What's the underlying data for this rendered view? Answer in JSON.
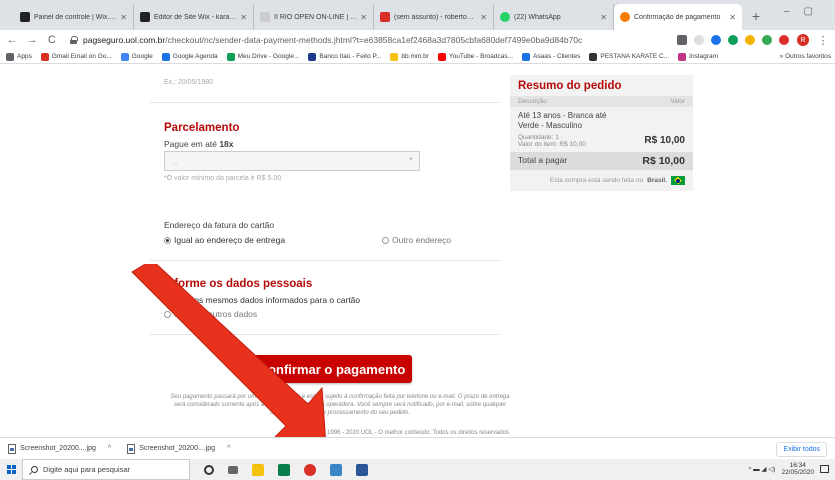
{
  "browser": {
    "tabs": [
      {
        "label": "Painel de controle | Wix.com",
        "color": "#222222"
      },
      {
        "label": "Editor de Site Wix - karateno",
        "color": "#222222"
      },
      {
        "label": "II RIO OPEN ON-LINE | karat",
        "color": "#cccccc"
      },
      {
        "label": "(sem assunto) - robertopesta",
        "color": "#d93025"
      },
      {
        "label": "(22) WhatsApp",
        "color": "#25d366"
      },
      {
        "label": "Confirmação de pagamento",
        "color": "#f57c00"
      }
    ],
    "new_tab": "+",
    "url_host": "pagseguro.uol.com.br",
    "url_path": "/checkout/nc/sender-data-payment-methods.jhtml?t=e63858ca1ef2468a3d7805cbfa680def7499e0ba9d84b70c",
    "profile_initial": "R",
    "bookmarks": [
      {
        "label": "Apps",
        "color": "#5f6368"
      },
      {
        "label": "Gmail Email on Go...",
        "color": "#d93025"
      },
      {
        "label": "Google",
        "color": "#4285f4"
      },
      {
        "label": "Google Agenda",
        "color": "#1a73e8"
      },
      {
        "label": "Meu Drive - Google...",
        "color": "#0f9d58"
      },
      {
        "label": "Banco Itaú - Feito P...",
        "color": "#1e3a8a"
      },
      {
        "label": "bb.mm.br",
        "color": "#f4c20d"
      },
      {
        "label": "YouTube - Broadcas...",
        "color": "#ff0000"
      },
      {
        "label": "Asaas - Clientes",
        "color": "#1a73e8"
      },
      {
        "label": "PESTANA KARATE C...",
        "color": "#333333"
      },
      {
        "label": "Instagram",
        "color": "#c13584"
      }
    ],
    "bookmarks_more": "»",
    "bookmarks_other": "Outros favoritos"
  },
  "form": {
    "prev_field_hint": "Ex.: 20/05/1980",
    "installments": {
      "title": "Parcelamento",
      "label_prefix": "Pague em até",
      "label_value": "18x",
      "select_placeholder": "...",
      "note": "*O valor mínimo da parcela é R$ 5.00"
    },
    "billing": {
      "label": "Endereço da fatura do cartão",
      "option_same": "Igual ao endereço de entrega",
      "option_other": "Outro endereço"
    },
    "personal": {
      "title": "Informe os dados pessoais",
      "option_same": "Usar os mesmos dados informados para o cartão",
      "option_other": "Informar outros dados"
    },
    "confirm_button": "Confirmar o pagamento",
    "disclaimer": "Seu pagamento passará por uma análise interna e estará sujeito à confirmação feita por telefone ou e-mail. O prazo de entrega será considerado somente após a confirmação feita pela operadora. Você sempre será notificado, por e-mail, sobre qualquer alteração no fluxo de processamento do seu pedido.",
    "footer": "© 1996 - 2020 UOL - O melhor conteúdo. Todos os direitos reservados"
  },
  "summary": {
    "title": "Resumo do pedido",
    "col_description": "Descrição",
    "col_value": "Valor",
    "item_name": "Até 13 anos - Branca até Verde - Masculino",
    "item_qty": "Quantidade: 1",
    "item_unit": "Valor do item: R$ 10,00",
    "item_price": "R$ 10,00",
    "total_label": "Total a pagar",
    "total_value": "R$ 10,00",
    "note_prefix": "Esta compra está sendo feita no",
    "note_country": "Brasil."
  },
  "downloads": {
    "items": [
      "Screenshot_20200....jpg",
      "Screenshot_20200....jpg"
    ],
    "show_all": "Exibir todos"
  },
  "taskbar": {
    "search_placeholder": "Digite aqui para pesquisar",
    "time": "16:34",
    "date": "22/05/2020"
  },
  "colors": {
    "accent_red": "#c80000",
    "heading_red": "#b40a0a",
    "annotation_arrow": "#e8321e"
  }
}
